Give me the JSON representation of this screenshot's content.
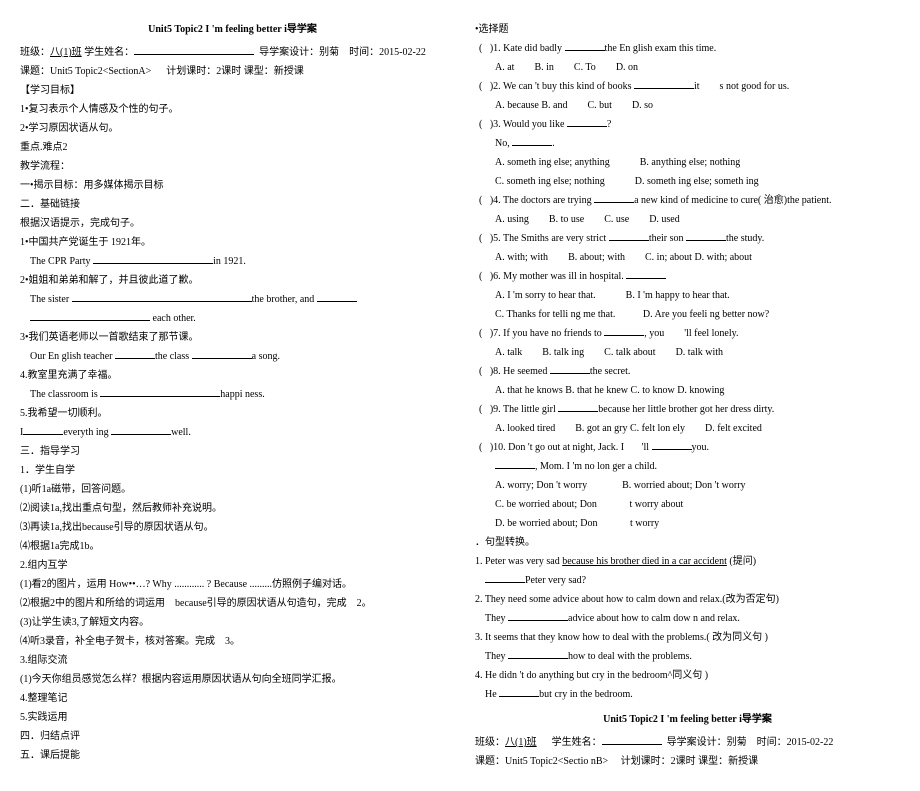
{
  "left": {
    "title": "Unit5 Topic2 I 'm feeling better i导学案",
    "class_label": "班级：",
    "class_val": "八(1)班",
    "student_label": " 学生姓名：",
    "design_label": "导学案设计：别菊",
    "time_label": "时间：2015-02-22",
    "topic_label": "课题：",
    "topic_val": "Unit5 Topic2<SectionA>",
    "plan": "计划课时：2课时 课型：新授课",
    "objectives_h": "【学习目标】",
    "obj1": "1•复习表示个人情感及个性的句子。",
    "obj2": "2•学习原因状语从句。",
    "key": "重点.难点2",
    "flow": "教学流程：",
    "s1": "一•揭示目标：用多媒体揭示目标",
    "s2": "二．基础链接",
    "s2sub": "根据汉语提示，完成句子。",
    "q1": "1•中国共产党诞生于 1921年。",
    "q1en_a": "The CPR Party",
    "q1en_b": "in 1921.",
    "q2": "2•姐姐和弟弟和解了，并且彼此道了歉。",
    "q2en_a": "The sister",
    "q2en_b": "the brother, and",
    "q2en_c": "each other.",
    "q3": "3•我们英语老师以一首歌结束了那节课。",
    "q3en_a": "Our En glish teacher",
    "q3en_b": "the class",
    "q3en_c": "a song.",
    "q4": "4.教室里充满了幸福。",
    "q4en_a": "The classroom is",
    "q4en_b": "happi ness.",
    "q5": "5.我希望一切顺利。",
    "q5en_a": "I",
    "q5en_b": "everyth ing",
    "q5en_c": "well.",
    "s3": "三．指导学习",
    "s3_1": "1．学生自学",
    "s3_1a": "(1)听1a磁带，回答问题。",
    "s3_1b": "⑵阅读1a,找出重点句型，然后教师补充说明。",
    "s3_1c": "⑶再读1a,找出because引导的原因状语从句。",
    "s3_1d": "⑷根据1a完成1b。",
    "s3_2": "2.组内互学",
    "s3_2a": "(1)看2的图片，运用 How••…? Why ............ ? Because .........仿照例子编对话。",
    "s3_2b": "⑵根据2中的图片和所给的词运用 because引导的原因状语从句造句，完成 2。",
    "s3_2c": "(3)让学生读3,了解短文内容。",
    "s3_2d": "⑷听3录音，补全电子贺卡，核对答案。完成 3。",
    "s3_3": "3.组际交流",
    "s3_3a": "(1)今天你组员感觉怎么样？根据内容运用原因状语从句向全班同学汇报。",
    "s3_4": "4.整理笔记",
    "s3_5": "5.实践运用",
    "s4": "四．归结点评",
    "s5": "五．课后提能"
  },
  "right": {
    "choice_h": "•选择题",
    "q1": ")1. Kate did badly",
    "q1b": "the En glish exam this time.",
    "q1o": {
      "a": "A. at",
      "b": "B. in",
      "c": "C. To",
      "d": "D. on"
    },
    "q2": ")2. We can 't buy this kind of books",
    "q2b": "it",
    "q2c": "s not good for us.",
    "q2o": {
      "a": "A. because B. and",
      "c": "C. but",
      "d": "D. so"
    },
    "q3a": ")3. Would you like",
    "q3a2": "?",
    "q3b": "No,",
    "q3b2": ".",
    "q3oA": "A. someth ing else; anything",
    "q3oB": "B. anything else; nothing",
    "q3oC": "C. someth ing else; nothing",
    "q3oD": "D. someth ing else; someth ing",
    "q4": ")4. The doctors are trying",
    "q4b": "a new kind of medicine to cure( 治愈)the patient.",
    "q4o": {
      "a": "A. using",
      "b": "B. to use",
      "c": "C. use",
      "d": "D. used"
    },
    "q5": ")5. The Smiths are very strict",
    "q5b": "their son",
    "q5c": "the study.",
    "q5o": {
      "a": "A. with; with",
      "b": "B. about; with",
      "c": "C. in; about D. with; about"
    },
    "q6": ")6. My mother was ill in hospital.",
    "q6o": {
      "a": "A. I 'm sorry to hear that.",
      "b": "B. I 'm happy to hear that.",
      "c": "C. Thanks for telli ng me that.",
      "d": "D. Are you feeli ng better now?"
    },
    "q7": ")7. If you have no friends to",
    "q7b": ", you",
    "q7c": "'ll feel lonely.",
    "q7o": {
      "a": "A. talk",
      "b": "B. talk ing",
      "c": "C. talk about",
      "d": "D. talk with"
    },
    "q8a": ")8. He seemed",
    "q8b": "the secret.",
    "q8o": "A. that he knows B. that he knew C. to know D. knowing",
    "q9": ")9. The little girl",
    "q9b": "because her little brother got her dress dirty.",
    "q9o": {
      "a": "A. looked tired",
      "b": "B. got an gry C. felt lon ely",
      "d": "D. felt excited"
    },
    "q10a": ")10. Don 't go out at night, Jack. I",
    "q10b": "'ll",
    "q10c": "you.",
    "q10d": ", Mom. I 'm no lon ger a child.",
    "q10oA": "A. worry; Don 't worry",
    "q10oB": "B. worried about; Don 't worry",
    "q10oC": "C. be worried about; Don",
    "q10oCb": "t worry about",
    "q10oD": "D. be worried about; Don",
    "q10oDb": "t worry",
    "tr_h": "．句型转换。",
    "tr1a": "1. Peter was very sad ",
    "tr1u": "because his brother died in a car accident",
    "tr1b": " (提问)",
    "tr1c": "Peter very sad?",
    "tr2": "2. They need some advice about how to calm down and relax.(改为否定句)",
    "tr2a": "They",
    "tr2b": "advice about how to calm dow n and relax.",
    "tr3": "3. It seems that they know how to deal with the problems.( 改为同义句 )",
    "tr3a": "They",
    "tr3b": "how to deal with the problems.",
    "tr4": "4. He didn 't do anything but cry in the bedroom^同义句 )",
    "tr4a": "He",
    "tr4b": "but cry in the bedroom.",
    "title2": "Unit5 Topic2 I 'm feeling better i导学案",
    "class_label": "班级：",
    "class_val": "八(1)班",
    "student_label": "学生姓名：",
    "design_label": "导学案设计：别菊",
    "time_label": "时间：2015-02-22",
    "topic_label": "课题：",
    "topic_val": "Unit5 Topic2<Sectio nB>",
    "plan": "计划课时：2课时 课型：新授课"
  }
}
